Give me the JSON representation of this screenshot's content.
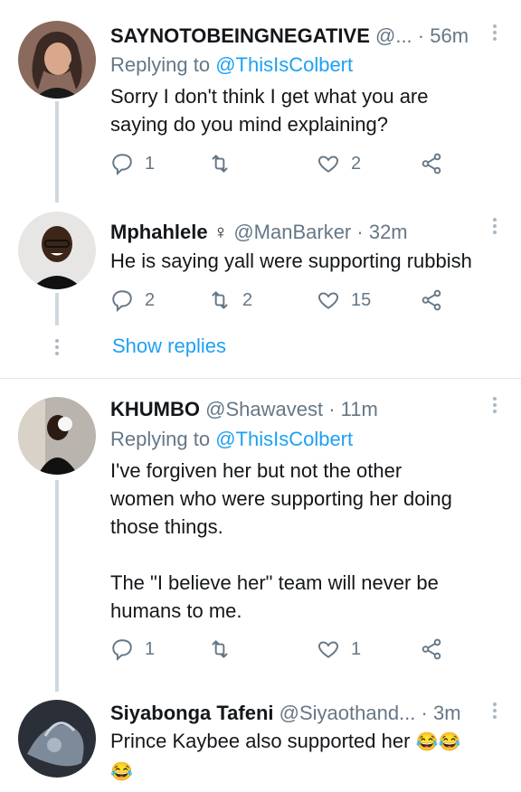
{
  "tweets": [
    {
      "name": "SAYNOTOBEINGNEGATIVE",
      "handle": "@...",
      "time": "· 56m",
      "replying_label": "Replying to ",
      "replying_mention": "@ThisIsColbert",
      "text_lines": [
        "Sorry I don't think I get what you are",
        "saying do you mind explaining?"
      ],
      "replies": "1",
      "retweets": "",
      "likes": "2"
    },
    {
      "name": "Mphahlele",
      "name_symbol": "♀",
      "handle": "@ManBarker",
      "time": "· 32m",
      "text_lines": [
        "He is saying yall were supporting rubbish"
      ],
      "replies": "2",
      "retweets": "2",
      "likes": "15"
    },
    {
      "name": "KHUMBO",
      "handle": "@Shawavest",
      "time": "· 11m",
      "replying_label": "Replying to ",
      "replying_mention": "@ThisIsColbert",
      "text_lines": [
        "I've forgiven her but not the other",
        "women who were supporting her doing",
        "those things.",
        "",
        "The \"I believe her\" team will never be",
        "humans to me."
      ],
      "replies": "1",
      "retweets": "",
      "likes": "1"
    },
    {
      "name": "Siyabonga Tafeni",
      "handle": "@Siyaothand...",
      "time": "· 3m",
      "text_line1": "Prince Kaybee also supported her",
      "emoji1": "😂😂",
      "emoji2": "😂"
    }
  ],
  "show_replies_label": "Show replies",
  "icons": {
    "reply": "reply-icon",
    "retweet": "retweet-icon",
    "like": "heart-icon",
    "share": "share-icon",
    "more": "more-vertical-icon"
  },
  "colors": {
    "accent": "#1da1f2",
    "secondary_text": "#657786",
    "thread_line": "#cfd9de"
  }
}
